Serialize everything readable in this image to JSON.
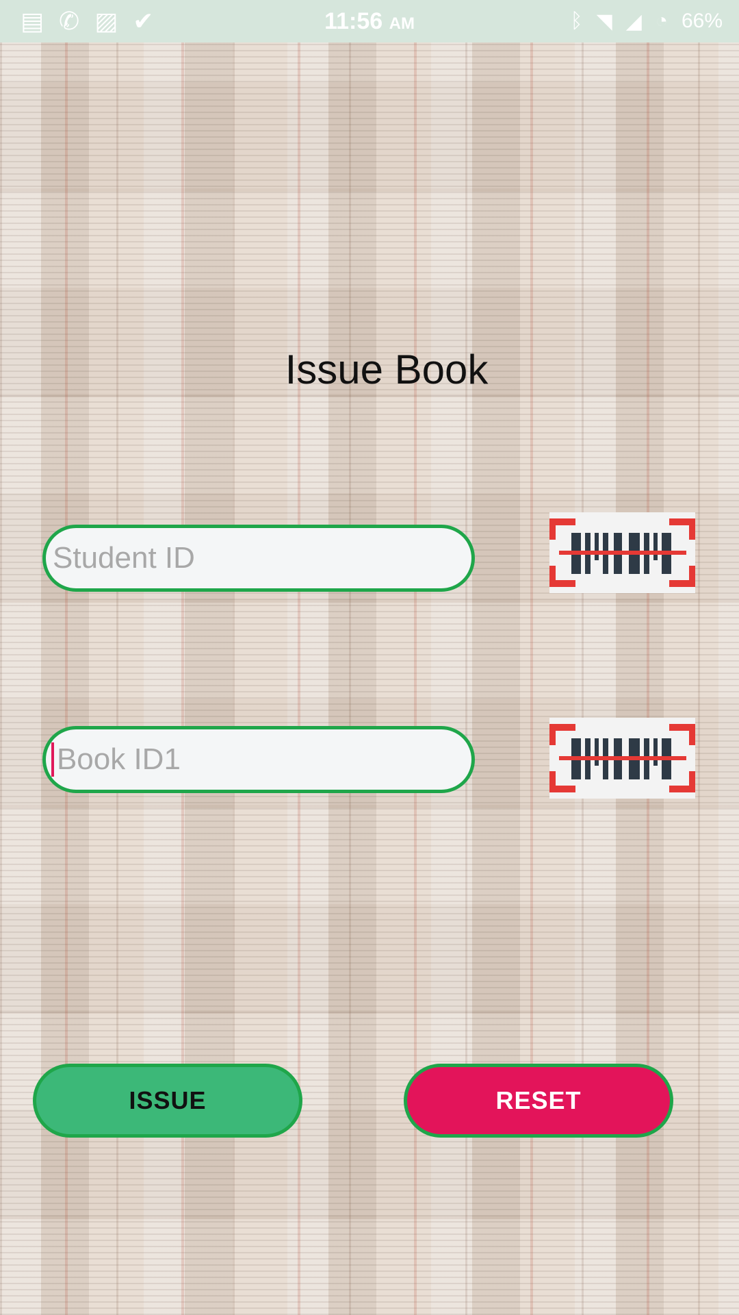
{
  "status_bar": {
    "time": "11:56",
    "time_suffix": "AM",
    "battery": "66%",
    "left_icons": [
      "notes-icon",
      "whatsapp-icon",
      "image-icon",
      "download-check-icon"
    ],
    "right_icons": [
      "bluetooth-icon",
      "wifi-icon",
      "signal-icon",
      "battery-icon"
    ]
  },
  "page": {
    "title": "Issue Book"
  },
  "form": {
    "student_id_placeholder": "Student ID",
    "book_id_placeholder": "Book ID1"
  },
  "buttons": {
    "issue_label": "ISSUE",
    "reset_label": "RESET"
  },
  "colors": {
    "field_border": "#1fa64a",
    "issue_bg": "#3cb878",
    "reset_bg": "#e3145a",
    "scanner_red": "#e53935",
    "scanner_bars": "#2e3a46"
  }
}
